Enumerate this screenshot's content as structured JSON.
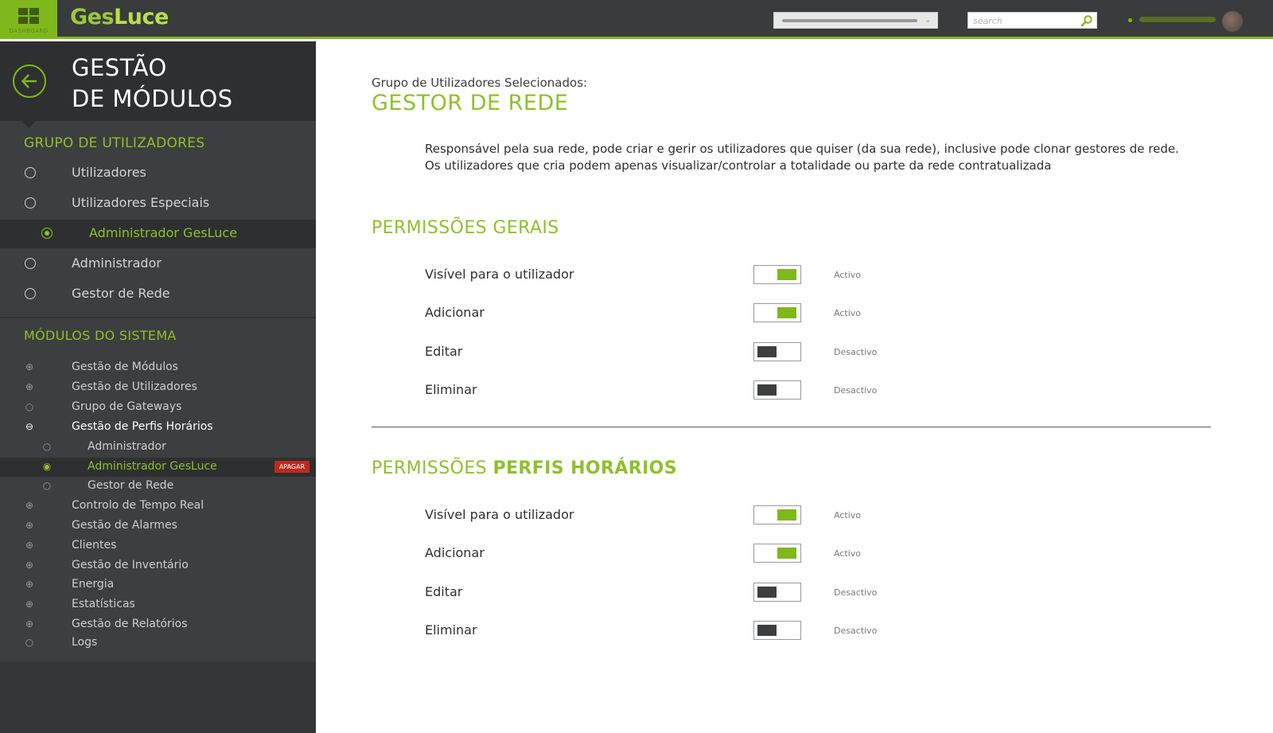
{
  "topbar": {
    "dashboard_label": "DASHBOARD",
    "brand_part1": "Ges",
    "brand_part2": "Luce",
    "search_placeholder": "search",
    "colors": {
      "accent": "#7fb81c",
      "bar": "#3a3b3c"
    }
  },
  "sidebar": {
    "title_line1": "GESTÃO",
    "title_line2": "DE MÓDULOS",
    "group_heading": "GRUPO DE UTILIZADORES",
    "groups": [
      {
        "label": "Utilizadores",
        "selected": false
      },
      {
        "label": "Utilizadores Especiais",
        "selected": false
      },
      {
        "label": "Administrador GesLuce",
        "selected": true
      },
      {
        "label": "Administrador",
        "selected": false
      },
      {
        "label": "Gestor de Rede",
        "selected": false
      }
    ],
    "modules_heading": "MÓDULOS DO SISTEMA",
    "modules": [
      {
        "label": "Gestão de Módulos",
        "icon": "plus-circle-icon"
      },
      {
        "label": "Gestão de Utilizadores",
        "icon": "plus-circle-icon"
      },
      {
        "label": "Grupo de Gateways",
        "icon": "circle-icon"
      },
      {
        "label": "Gestão de Perfis Horários",
        "icon": "minus-circle-icon"
      },
      {
        "label": "Administrador",
        "icon": "circle-icon"
      },
      {
        "label": "Administrador GesLuce",
        "icon": "radio-selected-icon"
      },
      {
        "label": "Gestor de Rede",
        "icon": "circle-icon"
      },
      {
        "label": "Controlo de Tempo Real",
        "icon": "plus-circle-icon"
      },
      {
        "label": "Gestão de Alarmes",
        "icon": "plus-circle-icon"
      },
      {
        "label": "Clientes",
        "icon": "plus-circle-icon"
      },
      {
        "label": "Gestão de Inventário",
        "icon": "plus-circle-icon"
      },
      {
        "label": "Energia",
        "icon": "plus-circle-icon"
      },
      {
        "label": "Estatísticas",
        "icon": "plus-circle-icon"
      },
      {
        "label": "Gestão de Relatórios",
        "icon": "plus-circle-icon"
      },
      {
        "label": "Logs",
        "icon": "circle-icon"
      }
    ],
    "apagar_label": "APAGAR"
  },
  "main": {
    "selected_group_label": "Grupo de Utilizadores Selecionados:",
    "selected_group_name": "GESTOR DE REDE",
    "description": "Responsável pela sua rede, pode criar e gerir os utilizadores que quiser (da sua rede), inclusive pode clonar gestores de rede. Os utilizadores que cria podem apenas visualizar/controlar a totalidade ou parte da rede contratualizada",
    "section1": {
      "title": "PERMISSÕES GERAIS",
      "permissions": [
        {
          "label": "Visível para o utilizador",
          "state": "Activo",
          "on": true
        },
        {
          "label": "Adicionar",
          "state": "Activo",
          "on": true
        },
        {
          "label": "Editar",
          "state": "Desactivo",
          "on": false
        },
        {
          "label": "Eliminar",
          "state": "Desactivo",
          "on": false
        }
      ]
    },
    "section2": {
      "title_prefix": "PERMISSÕES",
      "title_bold": "PERFIS HORÁRIOS",
      "permissions": [
        {
          "label": "Visível para o utilizador",
          "state": "Activo",
          "on": true
        },
        {
          "label": "Adicionar",
          "state": "Activo",
          "on": true
        },
        {
          "label": "Editar",
          "state": "Desactivo",
          "on": false
        },
        {
          "label": "Eliminar",
          "state": "Desactivo",
          "on": false
        }
      ]
    }
  }
}
